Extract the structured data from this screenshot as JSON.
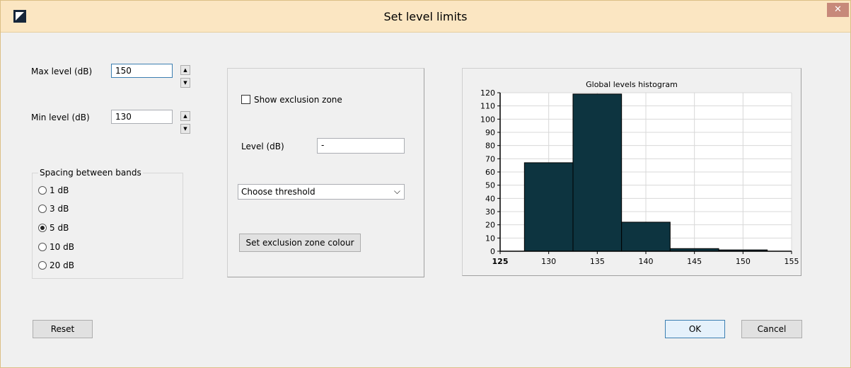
{
  "window": {
    "title": "Set level limits",
    "close_glyph": "✕"
  },
  "levels": {
    "max_label": "Max level (dB)",
    "max_value": "150",
    "min_label": "Min level (dB)",
    "min_value": "130",
    "spin_up": "▲",
    "spin_down": "▼"
  },
  "spacing": {
    "title": "Spacing between bands",
    "options": [
      "1 dB",
      "3 dB",
      "5 dB",
      "10 dB",
      "20 dB"
    ],
    "selected": "5 dB"
  },
  "exclusion": {
    "show_label": "Show exclusion zone",
    "show_checked": false,
    "level_label": "Level (dB)",
    "level_value": "-",
    "threshold_value": "Choose threshold",
    "colour_button": "Set exclusion zone colour"
  },
  "buttons": {
    "reset": "Reset",
    "ok": "OK",
    "cancel": "Cancel"
  },
  "chart_data": {
    "type": "bar",
    "title": "Global levels histogram",
    "bar_color": "#0d3440",
    "x_ticks": [
      125,
      130,
      135,
      140,
      145,
      150,
      155
    ],
    "y_ticks": [
      0,
      10,
      20,
      30,
      40,
      50,
      60,
      70,
      80,
      90,
      100,
      110,
      120
    ],
    "xlim": [
      125,
      155
    ],
    "ylim": [
      0,
      120
    ],
    "grid": true,
    "bins": [
      {
        "from": 127.5,
        "to": 132.5,
        "value": 67
      },
      {
        "from": 132.5,
        "to": 137.5,
        "value": 119
      },
      {
        "from": 137.5,
        "to": 142.5,
        "value": 22
      },
      {
        "from": 142.5,
        "to": 147.5,
        "value": 2
      },
      {
        "from": 147.5,
        "to": 152.5,
        "value": 1
      }
    ]
  }
}
